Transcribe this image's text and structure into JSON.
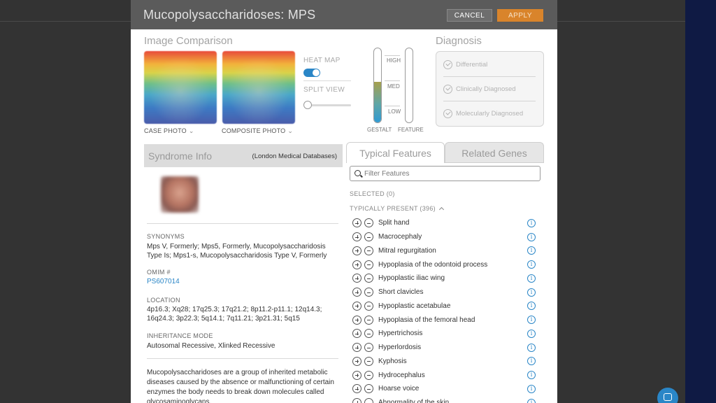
{
  "header": {
    "title": "Mucopolysaccharidoses: MPS",
    "cancel_label": "CANCEL",
    "apply_label": "APPLY"
  },
  "comparison": {
    "title": "Image Comparison",
    "case_photo_label": "CASE PHOTO",
    "composite_photo_label": "COMPOSITE PHOTO",
    "heat_map_label": "HEAT MAP",
    "heat_map_on": true,
    "split_view_label": "SPLIT VIEW",
    "split_view_level": 0,
    "gauge": {
      "high_label": "HIGH",
      "med_label": "MED",
      "low_label": "LOW",
      "gestalt_label": "GESTALT",
      "feature_label": "FEATURE",
      "gestalt_fill": 0.55,
      "feature_fill": 0
    }
  },
  "diagnosis": {
    "title": "Diagnosis",
    "items": [
      {
        "label": "Differential"
      },
      {
        "label": "Clinically Diagnosed"
      },
      {
        "label": "Molecularly Diagnosed"
      }
    ]
  },
  "syndrome": {
    "title": "Syndrome Info",
    "source": "(London Medical Databases)",
    "synonyms_label": "SYNONYMS",
    "synonyms": "Mps V, Formerly; Mps5, Formerly, Mucopolysaccharidosis Type Is; Mps1-s, Mucopolysaccharidosis Type V, Formerly",
    "omim_label": "OMIM #",
    "omim": "PS607014",
    "location_label": "LOCATION",
    "location": "4p16.3; Xq28; 17q25.3; 17q21.2; 8p11.2-p11.1; 12q14.3; 16q24.3; 3p22.3; 5q14.1; 7q11.21; 3p21.31; 5q15",
    "inheritance_label": "INHERITANCE MODE",
    "inheritance": "Autosomal Recessive, Xlinked Recessive",
    "description": "Mucopolysaccharidoses are a group of inherited metabolic diseases caused by the absence or malfunctioning of certain enzymes the body needs to break down molecules called glycosaminoglycans."
  },
  "tabs": {
    "typical_features": "Typical Features",
    "related_genes": "Related Genes"
  },
  "features": {
    "filter_placeholder": "Filter Features",
    "selected_label": "SELECTED (0)",
    "typically_present_label": "TYPICALLY PRESENT (396)",
    "items": [
      "Split hand",
      "Macrocephaly",
      "Mitral regurgitation",
      "Hypoplasia of the odontoid process",
      "Hypoplastic iliac wing",
      "Short clavicles",
      "Hypoplastic acetabulae",
      "Hypoplasia of the femoral head",
      "Hypertrichosis",
      "Hyperlordosis",
      "Kyphosis",
      "Hydrocephalus",
      "Hoarse voice",
      "Abnormality of the skin"
    ]
  },
  "colors": {
    "accent": "#2a86c7",
    "apply": "#d9842b",
    "header": "#5b5b5b"
  }
}
